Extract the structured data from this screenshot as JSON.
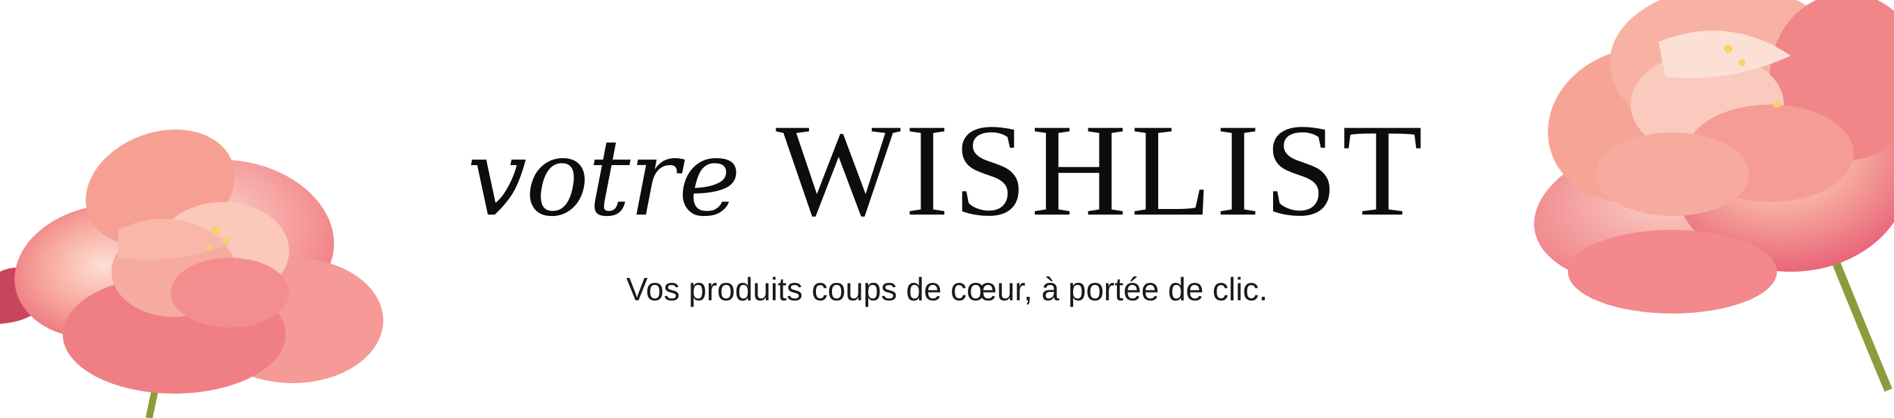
{
  "banner": {
    "title_script": "votre",
    "title_main": "WISHLIST",
    "subtitle": "Vos produits coups de cœur, à portée de clic."
  },
  "images": {
    "left_flower": "peony-flower-image",
    "right_flower": "peony-flower-image"
  },
  "colors": {
    "petal_light": "#f7b3a6",
    "petal_mid": "#f28b86",
    "petal_dark": "#e8667a",
    "stem": "#8f9a3c",
    "text": "#0d0d0d"
  }
}
